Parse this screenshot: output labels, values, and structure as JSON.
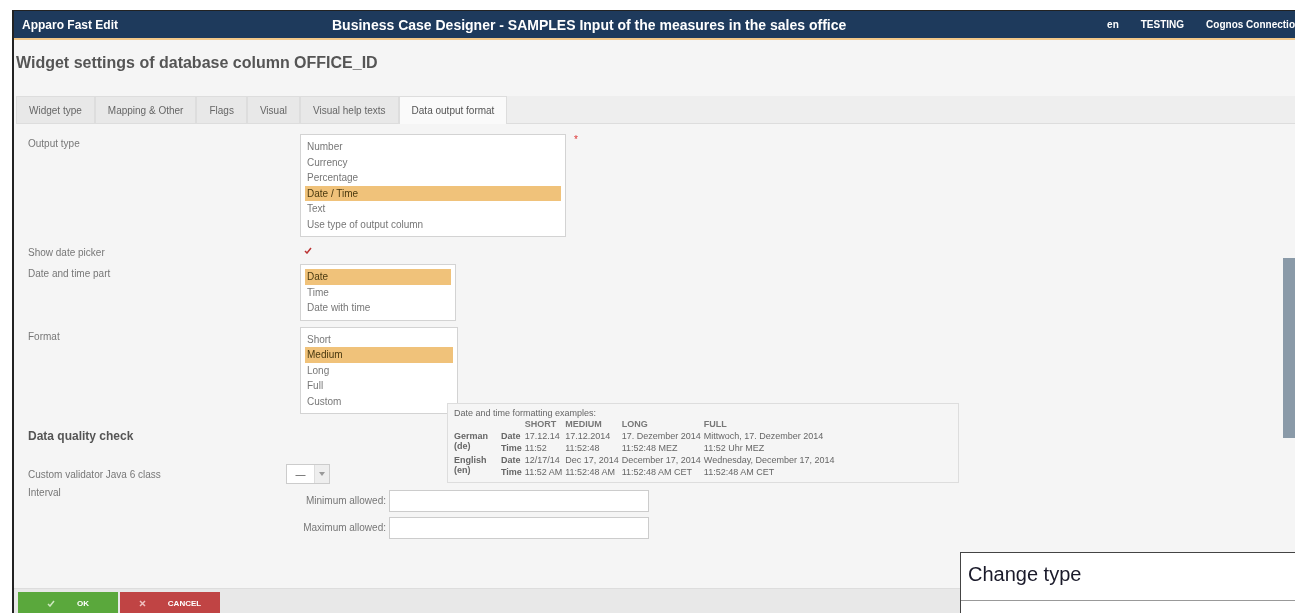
{
  "header": {
    "app_name": "Apparo Fast Edit",
    "title": "Business Case Designer - SAMPLES Input of the measures in the sales office",
    "links": [
      "en",
      "TESTING",
      "Cognos Connectio"
    ]
  },
  "page_title": "Widget settings of database column OFFICE_ID",
  "tabs": [
    {
      "label": "Widget type",
      "selected": false
    },
    {
      "label": "Mapping & Other",
      "selected": false
    },
    {
      "label": "Flags",
      "selected": false
    },
    {
      "label": "Visual",
      "selected": false
    },
    {
      "label": "Visual help texts",
      "selected": false
    },
    {
      "label": "Data output format",
      "selected": true
    }
  ],
  "output_type": {
    "label": "Output type",
    "required": true,
    "required_mark": "*",
    "options": [
      {
        "label": "Number",
        "selected": false
      },
      {
        "label": "Currency",
        "selected": false
      },
      {
        "label": "Percentage",
        "selected": false
      },
      {
        "label": "Date / Time",
        "selected": true
      },
      {
        "label": "Text",
        "selected": false
      },
      {
        "label": "Use type of output column",
        "selected": false
      }
    ]
  },
  "show_date_picker": {
    "label": "Show date picker",
    "checked": true
  },
  "date_time_part": {
    "label": "Date and time part",
    "options": [
      {
        "label": "Date",
        "selected": true
      },
      {
        "label": "Time",
        "selected": false
      },
      {
        "label": "Date with time",
        "selected": false
      }
    ]
  },
  "format": {
    "label": "Format",
    "options": [
      {
        "label": "Short",
        "selected": false
      },
      {
        "label": "Medium",
        "selected": true
      },
      {
        "label": "Long",
        "selected": false
      },
      {
        "label": "Full",
        "selected": false
      },
      {
        "label": "Custom",
        "selected": false
      }
    ]
  },
  "examples": {
    "title": "Date and time formatting examples:",
    "columns": [
      "SHORT",
      "MEDIUM",
      "LONG",
      "FULL"
    ],
    "languages": [
      {
        "language": "German (de)",
        "rows": [
          {
            "part": "Date",
            "values": [
              "17.12.14",
              "17.12.2014",
              "17. Dezember 2014",
              "Mittwoch, 17. Dezember 2014"
            ]
          },
          {
            "part": "Time",
            "values": [
              "11:52",
              "11:52:48",
              "11:52:48 MEZ",
              "11:52 Uhr MEZ"
            ]
          }
        ]
      },
      {
        "language": "English (en)",
        "rows": [
          {
            "part": "Date",
            "values": [
              "12/17/14",
              "Dec 17, 2014",
              "December 17, 2014",
              "Wednesday, December 17, 2014"
            ]
          },
          {
            "part": "Time",
            "values": [
              "11:52 AM",
              "11:52:48 AM",
              "11:52:48 AM CET",
              "11:52:48 AM CET"
            ]
          }
        ]
      }
    ]
  },
  "data_quality": {
    "heading": "Data quality check",
    "validator": {
      "label": "Custom validator Java 6 class",
      "value": "—"
    },
    "interval": {
      "label": "Interval",
      "minimum_label": "Minimum allowed:",
      "maximum_label": "Maximum allowed:"
    }
  },
  "buttons": [
    {
      "kind": "ok",
      "label": "OK"
    },
    {
      "kind": "cancel",
      "label": "CANCEL"
    }
  ],
  "callout": "Change type"
}
